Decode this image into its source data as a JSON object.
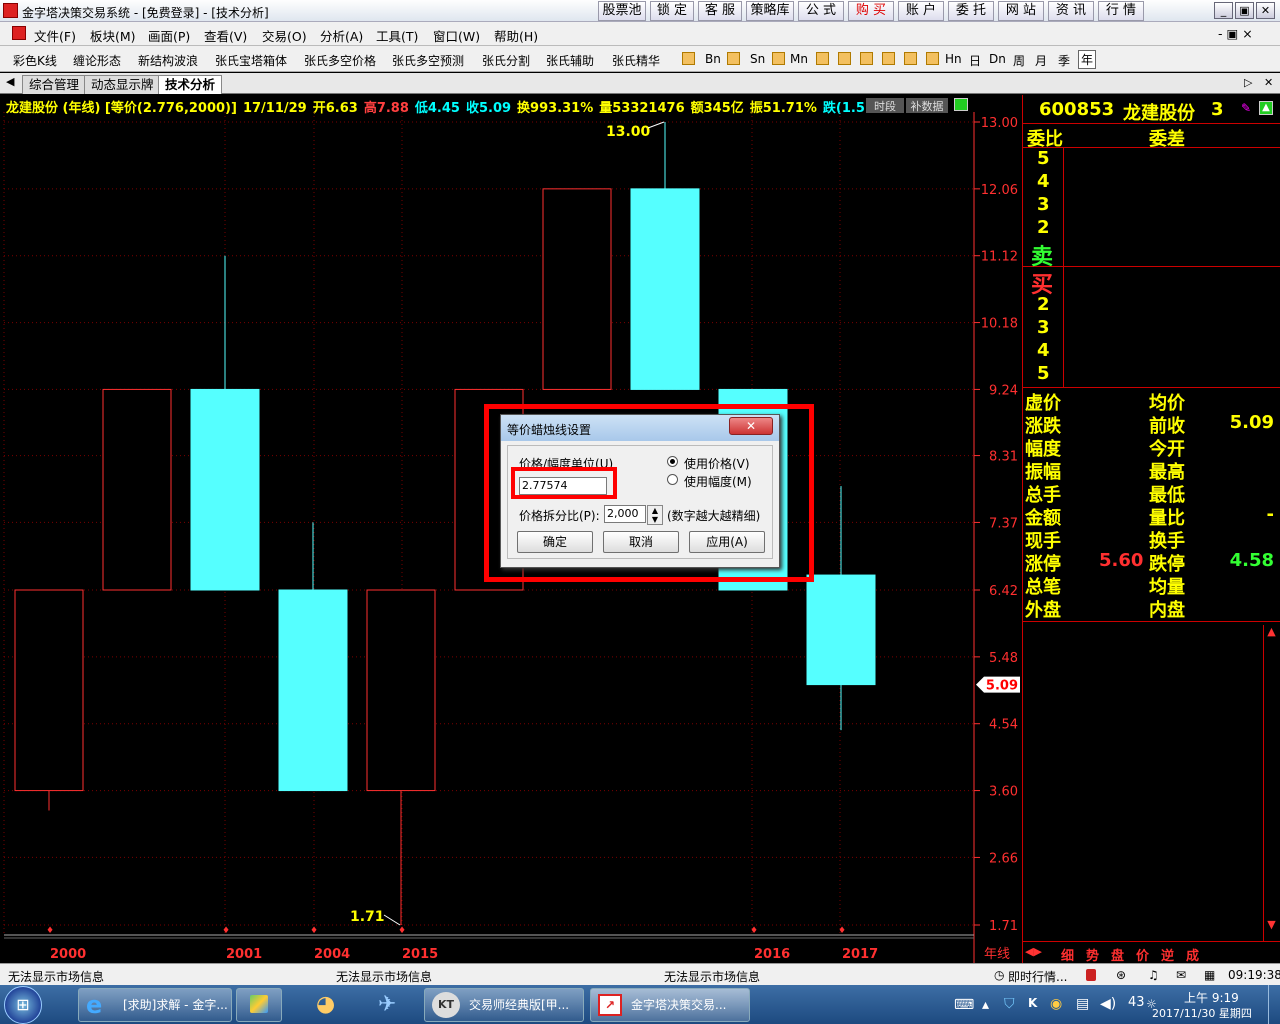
{
  "title_bar": {
    "title": "金字塔决策交易系统 - [免费登录] - [技术分析]",
    "buttons": [
      "股票池",
      "锁 定",
      "客 服",
      "策略库",
      "公 式",
      "购 买",
      "账 户",
      "委 托",
      "网 站",
      "资 讯",
      "行 情"
    ],
    "window_controls": [
      "_",
      "▣",
      "✕"
    ]
  },
  "menu": {
    "items": [
      "文件(F)",
      "板块(M)",
      "画面(P)",
      "查看(V)",
      "交易(O)",
      "分析(A)",
      "工具(T)",
      "窗口(W)",
      "帮助(H)"
    ],
    "mdi_controls": "- ▣ ×"
  },
  "toolbar": {
    "items": [
      "彩色K线",
      "缠论形态",
      "新结构波浪",
      "张氏宝塔箱体",
      "张氏多空价格",
      "张氏多空预测",
      "张氏分割",
      "张氏辅助",
      "张氏精华"
    ],
    "periods": [
      "Bn",
      "Sn",
      "Mn",
      "Hn",
      "日",
      "Dn",
      "周",
      "月",
      "季",
      "年"
    ]
  },
  "tabs": {
    "items": [
      "综合管理",
      "动态显示牌",
      "技术分析"
    ],
    "active": "技术分析"
  },
  "quote_line": [
    {
      "text": "龙建股份 (年线) [等价(2.776,2000)]",
      "color": "#ffff00"
    },
    {
      "text": "17/11/29",
      "color": "#ffff00"
    },
    {
      "text": "开6.63",
      "color": "#ffff00"
    },
    {
      "text": "高7.88",
      "color": "#ff4040"
    },
    {
      "text": "低4.45",
      "color": "#00ffff"
    },
    {
      "text": "收5.09",
      "color": "#00ffff"
    },
    {
      "text": "换993.31%",
      "color": "#ffff00"
    },
    {
      "text": "量53321476",
      "color": "#ffff00"
    },
    {
      "text": "额345亿",
      "color": "#ffff00"
    },
    {
      "text": "振51.71%",
      "color": "#ffff00"
    },
    {
      "text": "跌(1.5",
      "color": "#00ffff"
    }
  ],
  "chart_buttons": [
    "时段",
    "补数据"
  ],
  "chart_data": {
    "type": "candlestick",
    "title": "",
    "ylim": [
      1.71,
      13.0
    ],
    "y_ticks": [
      "13.00",
      "12.06",
      "11.12",
      "10.18",
      "9.24",
      "8.31",
      "7.37",
      "6.42",
      "5.48",
      "4.54",
      "3.60",
      "2.66",
      "1.71"
    ],
    "x_labels": [
      "2000",
      "2001",
      "2004",
      "2015",
      "2016",
      "2017"
    ],
    "x_axis_tag": "年线",
    "current_price": "5.09",
    "annotations": {
      "high": "13.00",
      "low": "1.71"
    },
    "candles": [
      {
        "open": 6.42,
        "close": 3.6,
        "high": 6.42,
        "low": 3.32,
        "color": "red-hollow"
      },
      {
        "open": 6.42,
        "close": 9.24,
        "high": 9.24,
        "low": 6.42,
        "color": "red-hollow"
      },
      {
        "open": 9.24,
        "close": 6.42,
        "high": 11.12,
        "low": 6.42,
        "color": "cyan"
      },
      {
        "open": 6.42,
        "close": 3.6,
        "high": 7.37,
        "low": 3.6,
        "color": "cyan"
      },
      {
        "open": 3.6,
        "close": 6.42,
        "high": 6.42,
        "low": 1.71,
        "color": "red-hollow"
      },
      {
        "open": 6.42,
        "close": 9.24,
        "high": 9.24,
        "low": 6.42,
        "color": "red-hollow"
      },
      {
        "open": 9.24,
        "close": 12.06,
        "high": 12.06,
        "low": 9.24,
        "color": "red-hollow"
      },
      {
        "open": 12.06,
        "close": 9.24,
        "high": 13.0,
        "low": 9.24,
        "color": "cyan"
      },
      {
        "open": 9.24,
        "close": 6.42,
        "high": 9.24,
        "low": 6.42,
        "color": "cyan"
      },
      {
        "open": 6.63,
        "close": 5.09,
        "high": 7.88,
        "low": 4.45,
        "color": "cyan"
      }
    ]
  },
  "right_panel": {
    "code": "600853",
    "name": "龙建股份",
    "suffix": "3",
    "header_left": "委比",
    "header_right": "委差",
    "sell_levels": [
      "5",
      "4",
      "3",
      "2",
      "卖"
    ],
    "buy_levels": [
      "买",
      "2",
      "3",
      "4",
      "5"
    ],
    "stats": [
      {
        "l": "虚价",
        "v1": "",
        "r": "均价",
        "v2": ""
      },
      {
        "l": "涨跌",
        "v1": "",
        "r": "前收",
        "v2": "5.09"
      },
      {
        "l": "幅度",
        "v1": "",
        "r": "今开",
        "v2": ""
      },
      {
        "l": "振幅",
        "v1": "",
        "r": "最高",
        "v2": ""
      },
      {
        "l": "总手",
        "v1": "",
        "r": "最低",
        "v2": ""
      },
      {
        "l": "金额",
        "v1": "",
        "r": "量比",
        "v2": "-"
      },
      {
        "l": "现手",
        "v1": "",
        "r": "换手",
        "v2": ""
      },
      {
        "l": "涨停",
        "v1": "5.60",
        "r": "跌停",
        "v2": "4.58"
      },
      {
        "l": "总笔",
        "v1": "",
        "r": "均量",
        "v2": ""
      },
      {
        "l": "外盘",
        "v1": "",
        "r": "内盘",
        "v2": ""
      }
    ],
    "bottom_tabs": [
      "细",
      "势",
      "盘",
      "价",
      "逆",
      "成"
    ]
  },
  "dialog": {
    "title": "等价蜡烛线设置",
    "price_unit_label": "价格/幅度单位(U)",
    "price_unit_value": "2.77574",
    "radio_price": "使用价格(V)",
    "radio_range": "使用幅度(M)",
    "split_label": "价格拆分比(P):",
    "split_value": "2,000",
    "split_hint": "(数字越大越精细)",
    "ok": "确定",
    "cancel": "取消",
    "apply": "应用(A)"
  },
  "status_bar": {
    "msg1": "无法显示市场信息",
    "msg2": "无法显示市场信息",
    "msg3": "无法显示市场信息",
    "realtime": "即时行情...",
    "time": "09:19:38"
  },
  "taskbar": {
    "tasks": [
      "[求助]求解 - 金字...",
      "交易师经典版[甲...",
      "金字塔决策交易..."
    ],
    "clock_time": "上午 9:19",
    "clock_date": "2017/11/30 星期四",
    "tray_num": "43"
  },
  "colors": {
    "up": "#ff3030",
    "down": "#55ffff",
    "text": "#ffff00",
    "grid": "#8b0000"
  }
}
